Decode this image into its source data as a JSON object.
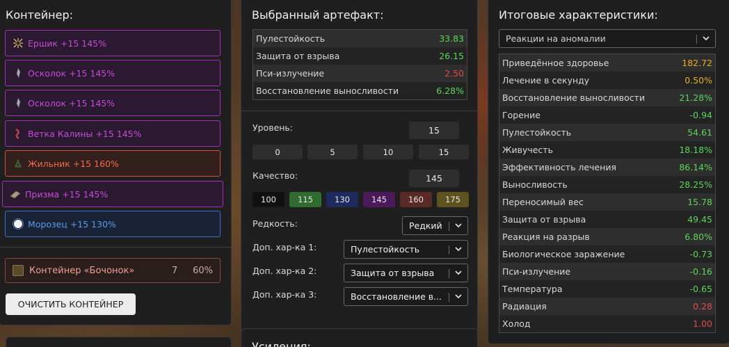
{
  "container": {
    "title": "Контейнер:",
    "slots": [
      {
        "label": "Ершик +15 145%",
        "icon": "urchin-icon",
        "color": "purple"
      },
      {
        "label": "Осколок +15 145%",
        "icon": "shard-icon",
        "color": "purple"
      },
      {
        "label": "Осколок +15 145%",
        "icon": "shard-icon",
        "color": "purple"
      },
      {
        "label": "Ветка Калины +15 145%",
        "icon": "branch-icon",
        "color": "purple"
      },
      {
        "label": "Жильник +15 160%",
        "icon": "vein-icon",
        "color": "orange"
      },
      {
        "label": "Призма +15 145%",
        "icon": "prism-icon",
        "color": "purple"
      },
      {
        "label": "Морозец +15 130%",
        "icon": "frost-icon",
        "color": "blue"
      }
    ],
    "container_item": {
      "name": "Контейнер «Бочонок»",
      "count": "7",
      "percent": "60%"
    },
    "clear_button": "ОЧИСТИТЬ КОНТЕЙНЕР"
  },
  "artifact": {
    "title": "Выбранный артефакт:",
    "stats": [
      {
        "name": "Пулестойкость",
        "value": "33.83",
        "color": "green"
      },
      {
        "name": "Защита от взрыва",
        "value": "26.15",
        "color": "green"
      },
      {
        "name": "Пси-излучение",
        "value": "2.50",
        "color": "red"
      },
      {
        "name": "Восстановление выносливости",
        "value": "6.28%",
        "color": "green"
      }
    ],
    "level_label": "Уровень:",
    "level_value": "15",
    "level_presets": [
      "0",
      "5",
      "10",
      "15"
    ],
    "quality_label": "Качество:",
    "quality_value": "145",
    "quality_presets": [
      {
        "label": "100",
        "color": "#111111"
      },
      {
        "label": "115",
        "color": "#2f6a2f"
      },
      {
        "label": "130",
        "color": "#1e2a5e"
      },
      {
        "label": "145",
        "color": "#4a1a5a"
      },
      {
        "label": "160",
        "color": "#5a2a26"
      },
      {
        "label": "175",
        "color": "#5e5220"
      }
    ],
    "rarity_label": "Редкость:",
    "rarity_value": "Редкий",
    "extra1_label": "Доп. хар-ка 1:",
    "extra1_value": "Пулестойкость",
    "extra2_label": "Доп. хар-ка 2:",
    "extra2_value": "Защита от взрыва",
    "extra3_label": "Доп. хар-ка 3:",
    "extra3_value": "Восстановление в...",
    "boosts_title": "Усиления:"
  },
  "totals": {
    "title": "Итоговые характеристики:",
    "filter_value": "Реакции на аномалии",
    "stats": [
      {
        "name": "Приведённое здоровье",
        "value": "182.72",
        "color": "yellow"
      },
      {
        "name": "Лечение в секунду",
        "value": "0.50%",
        "color": "yellow"
      },
      {
        "name": "Восстановление выносливости",
        "value": "21.28%",
        "color": "green"
      },
      {
        "name": "Горение",
        "value": "-0.94",
        "color": "green"
      },
      {
        "name": "Пулестойкость",
        "value": "54.61",
        "color": "green"
      },
      {
        "name": "Живучесть",
        "value": "18.18%",
        "color": "green"
      },
      {
        "name": "Эффективность лечения",
        "value": "86.14%",
        "color": "green"
      },
      {
        "name": "Выносливость",
        "value": "28.25%",
        "color": "green"
      },
      {
        "name": "Переносимый вес",
        "value": "15.78",
        "color": "green"
      },
      {
        "name": "Защита от взрыва",
        "value": "49.45",
        "color": "green"
      },
      {
        "name": "Реакция на разрыв",
        "value": "6.80%",
        "color": "green"
      },
      {
        "name": "Биологическое заражение",
        "value": "-0.73",
        "color": "green"
      },
      {
        "name": "Пси-излучение",
        "value": "-0.16",
        "color": "green"
      },
      {
        "name": "Температура",
        "value": "-0.65",
        "color": "green"
      },
      {
        "name": "Радиация",
        "value": "0.28",
        "color": "red"
      },
      {
        "name": "Холод",
        "value": "1.00",
        "color": "red"
      }
    ]
  }
}
